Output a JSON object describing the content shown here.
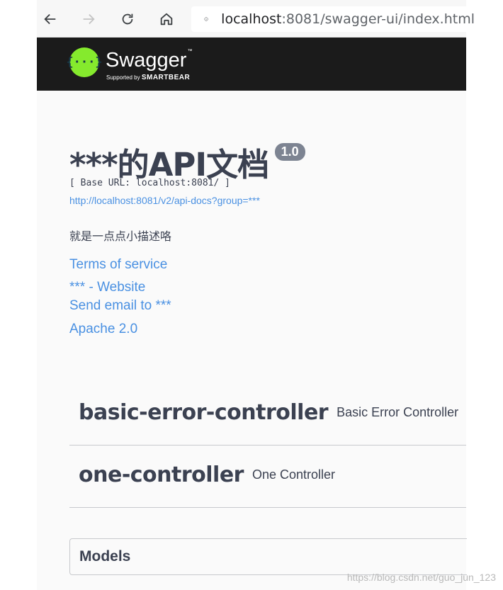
{
  "browser": {
    "url_host": "localhost",
    "url_rest": ":8081/swagger-ui/index.html"
  },
  "topbar": {
    "logo_symbol": "{···}",
    "brand_name": "Swagger",
    "tm": "™",
    "supported_by": "Supported by",
    "company": "SMARTBEAR"
  },
  "info": {
    "title": "***的API文档",
    "version": "1.0",
    "base_url": "[ Base URL: localhost:8081/ ]",
    "spec_url": "http://localhost:8081/v2/api-docs?group=***",
    "description": "就是一点点小描述咯",
    "terms": "Terms of service",
    "website": "*** - Website",
    "email": "Send email to ***",
    "license": "Apache 2.0"
  },
  "tags": [
    {
      "name": "basic-error-controller",
      "description": "Basic Error Controller"
    },
    {
      "name": "one-controller",
      "description": "One Controller"
    }
  ],
  "models": {
    "title": "Models"
  },
  "watermark": "https://blog.csdn.net/guo_jun_123",
  "colors": {
    "accent": "#4990e2",
    "logo_green": "#85ea2d",
    "topbar": "#1b1b1b",
    "text": "#3b4151"
  }
}
